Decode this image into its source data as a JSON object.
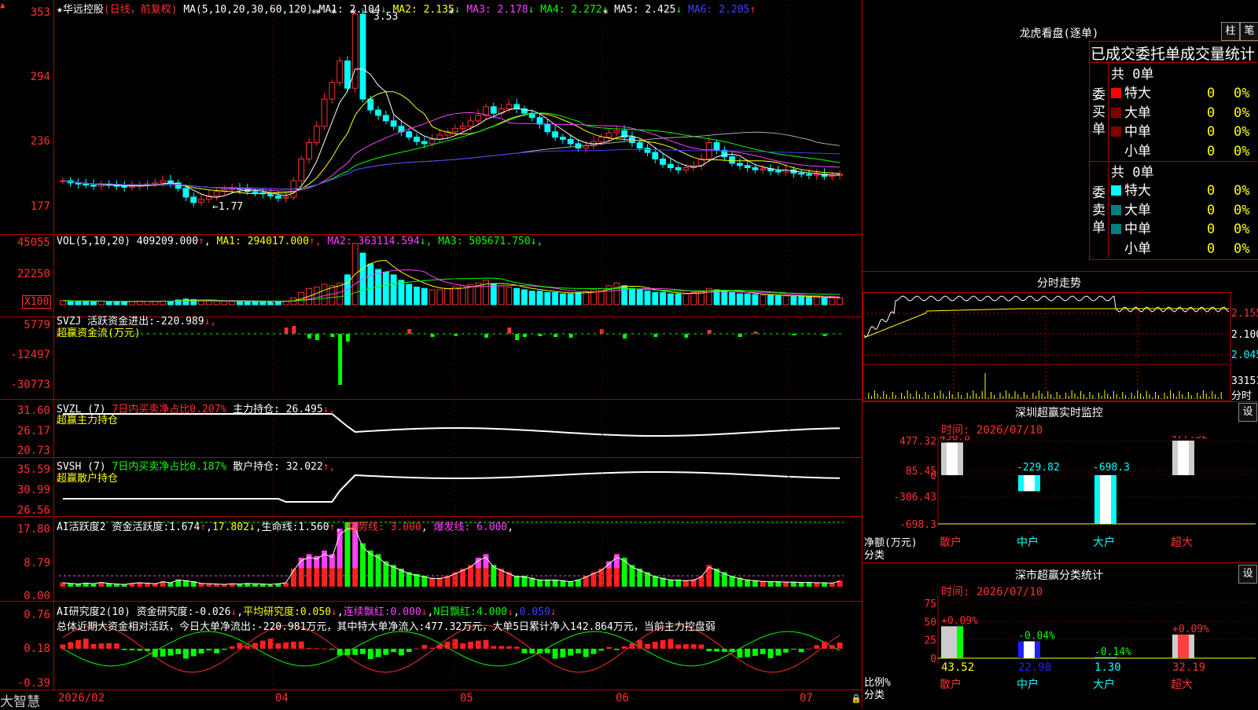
{
  "stock": {
    "name": "华远控股",
    "mode": "(日线，前复权)",
    "ma_header": "MA(5,10,20,30,60,120)",
    "ma_values": [
      {
        "label": "MA1:",
        "value": "2.104",
        "arrow": "↓",
        "color": "#ffffff"
      },
      {
        "label": "MA2:",
        "value": "2.135",
        "arrow": "↓",
        "color": "#ffff00"
      },
      {
        "label": "MA3:",
        "value": "2.178",
        "arrow": "↓",
        "color": "#ff40ff"
      },
      {
        "label": "MA4:",
        "value": "2.272",
        "arrow": "↓",
        "color": "#00ff00"
      },
      {
        "label": "MA5:",
        "value": "2.425",
        "arrow": "↓",
        "color": "#ffffff"
      },
      {
        "label": "MA6:",
        "value": "2.205",
        "arrow": "↑",
        "color": "#4040ff"
      }
    ],
    "high_mark": "3.53",
    "low_mark": "1.77",
    "y_ticks": [
      "353",
      "294",
      "236",
      "177"
    ]
  },
  "vol": {
    "header": "VOL(5,10,20)",
    "value": "409209.000",
    "arrow": "↑",
    "mas": [
      {
        "label": "MA1:",
        "value": "294017.000",
        "arrow": "↑",
        "color": "#ffff00"
      },
      {
        "label": "MA2:",
        "value": "363114.594",
        "arrow": "↓",
        "color": "#ff40ff"
      },
      {
        "label": "MA3:",
        "value": "505671.750",
        "arrow": "↓",
        "color": "#00ff00"
      }
    ],
    "y_ticks": [
      "45055",
      "22250"
    ],
    "unit": "X100"
  },
  "svzj": {
    "header": "SVZJ",
    "label": "活跃资金进出:",
    "value": "-220.989",
    "arrow": "↓,",
    "subtitle": "超赢资金流(万元)",
    "y_ticks": [
      "5779",
      "-12497",
      "-30773"
    ]
  },
  "svzl": {
    "header": "SVZL (7)",
    "ratio_label": "7日内买卖净占比0.207%",
    "hold_label": "主力持仓:",
    "hold_value": "26.495",
    "arrow": "↓,",
    "subtitle": "超赢主力持仓",
    "y_ticks": [
      "31.60",
      "26.17",
      "20.73"
    ]
  },
  "svsh": {
    "header": "SVSH (7)",
    "ratio_label": "7日内买卖净占比0.187%",
    "hold_label": "散户持仓:",
    "hold_value": "32.022",
    "arrow": "↑,",
    "subtitle": "超赢散户持仓",
    "y_ticks": [
      "35.59",
      "30.99",
      "26.56"
    ]
  },
  "ai_active": {
    "header": "AI活跃度2",
    "label": "资金活跃度:",
    "value": "1.674",
    "v2": "17.802",
    "life_label": "生命线:",
    "life_value": "1.560",
    "strong": "强势线: 3.000",
    "burst": "爆发线: 6.000",
    "y_ticks": [
      "17.80",
      "8.79",
      "0.00"
    ]
  },
  "ai_research": {
    "header": "AI研究度2(10)",
    "label": "资金研究度:",
    "value": "-0.026",
    "avg_label": "平均研究度:",
    "avg_value": "0.050",
    "streak_label": "连续飘红:",
    "streak_value": "0.000",
    "n_label": "N日飘红:",
    "n_value": "4.000",
    "last_value": "0.050",
    "summary": "总体近期大资金相对活跃，今日大单净流出:-220.981万元，其中特大单净流入:477.32万元，大单5日累计净入142.864万元，当前主力控盘弱",
    "y_ticks": [
      "0.76",
      "0.18",
      "-0.39"
    ]
  },
  "x_axis": {
    "labels": [
      "2026/02",
      "04",
      "05",
      "06",
      "07"
    ],
    "logo": "大智慧"
  },
  "dragon_tiger": {
    "title": "龙虎看盘(逐单)",
    "btn1": "柱",
    "btn2": "笔",
    "subtitle": "已成交委托单成交量统计",
    "buy_side": "委买单",
    "sell_side": "委卖单",
    "buy_total": "共 0单",
    "sell_total": "共 0单",
    "buy_rows": [
      {
        "name": "特大",
        "count": "0",
        "pct": "0%",
        "color": "#ff0000"
      },
      {
        "name": "大单",
        "count": "0",
        "pct": "0%",
        "color": "#800000"
      },
      {
        "name": "中单",
        "count": "0",
        "pct": "0%",
        "color": "#800000"
      },
      {
        "name": "小单",
        "count": "0",
        "pct": "0%",
        "color": ""
      }
    ],
    "sell_rows": [
      {
        "name": "特大",
        "count": "0",
        "pct": "0%",
        "color": "#00ffff"
      },
      {
        "name": "大单",
        "count": "0",
        "pct": "0%",
        "color": "#008080"
      },
      {
        "name": "中单",
        "count": "0",
        "pct": "0%",
        "color": "#008080"
      },
      {
        "name": "小单",
        "count": "0",
        "pct": "0%",
        "color": ""
      }
    ]
  },
  "intraday": {
    "title": "分时走势",
    "y_ticks": [
      "2.155",
      "2.100",
      "2.045"
    ],
    "vol_tick": "33151",
    "vol_label": "分时"
  },
  "monitor": {
    "title": "深圳超赢实时监控",
    "btn": "设",
    "time": "时间: 2026/07/10",
    "y_ticks": [
      "477.32",
      "85.45",
      "0",
      "-306.43",
      "-698.3"
    ],
    "unit_label": "净额(万元)",
    "cat_label": "分类",
    "bars": [
      {
        "name": "散户",
        "value": "450.8"
      },
      {
        "name": "中户",
        "value": "-229.82"
      },
      {
        "name": "大户",
        "value": "-698.3"
      },
      {
        "name": "超大",
        "value": "477.32"
      }
    ]
  },
  "classify": {
    "title": "深市超赢分类统计",
    "btn": "设",
    "time": "时间: 2026/07/10",
    "y_ticks": [
      "75",
      "50",
      "25",
      "0"
    ],
    "ratio_label": "比例%",
    "cat_label": "分类",
    "bars": [
      {
        "name": "散户",
        "pct": "+0.09%",
        "value": "43.52"
      },
      {
        "name": "中户",
        "pct": "-0.04%",
        "value": "22.98"
      },
      {
        "name": "大户",
        "pct": "-0.14%",
        "value": "1.30"
      },
      {
        "name": "超大",
        "pct": "+0.09%",
        "value": "32.19"
      }
    ]
  },
  "chart_data": {
    "type": "candlestick",
    "price_scale": [
      1.77,
      3.53
    ],
    "close": [
      2.0,
      1.98,
      1.97,
      1.96,
      1.95,
      1.97,
      1.96,
      1.95,
      1.94,
      1.95,
      1.96,
      1.97,
      1.98,
      2.0,
      1.98,
      1.93,
      1.85,
      1.8,
      1.83,
      1.86,
      1.9,
      1.92,
      1.93,
      1.92,
      1.9,
      1.89,
      1.88,
      1.86,
      1.84,
      1.85,
      2.0,
      2.2,
      2.35,
      2.5,
      2.75,
      2.9,
      3.1,
      2.85,
      3.53,
      2.75,
      2.65,
      2.6,
      2.55,
      2.5,
      2.45,
      2.4,
      2.36,
      2.34,
      2.38,
      2.42,
      2.45,
      2.48,
      2.5,
      2.55,
      2.6,
      2.68,
      2.62,
      2.66,
      2.7,
      2.66,
      2.62,
      2.58,
      2.52,
      2.45,
      2.4,
      2.38,
      2.34,
      2.3,
      2.32,
      2.36,
      2.4,
      2.44,
      2.46,
      2.4,
      2.35,
      2.3,
      2.26,
      2.2,
      2.15,
      2.12,
      2.1,
      2.12,
      2.14,
      2.2,
      2.35,
      2.28,
      2.22,
      2.16,
      2.14,
      2.12,
      2.1,
      2.11,
      2.09,
      2.08,
      2.1,
      2.07,
      2.06,
      2.05,
      2.06,
      2.04,
      2.05,
      2.06
    ],
    "vol_scale": [
      0,
      45055
    ],
    "volume": [
      3000,
      2800,
      2500,
      2600,
      2400,
      2600,
      2500,
      2400,
      2300,
      2500,
      2700,
      2600,
      2400,
      2800,
      2600,
      3500,
      4200,
      3800,
      3000,
      2800,
      2700,
      2600,
      2500,
      2400,
      2300,
      2500,
      2400,
      2300,
      2400,
      2600,
      5000,
      9000,
      12000,
      13000,
      15000,
      14000,
      16000,
      22000,
      45055,
      38000,
      30000,
      26000,
      24000,
      22000,
      18000,
      15000,
      13000,
      12000,
      11000,
      11000,
      12000,
      13000,
      14000,
      15000,
      16000,
      18000,
      15000,
      14000,
      13000,
      12000,
      11000,
      10000,
      10000,
      9000,
      9000,
      8000,
      8000,
      9000,
      10000,
      11000,
      12000,
      14000,
      16000,
      14000,
      12000,
      11000,
      10000,
      9000,
      9000,
      8000,
      8000,
      8000,
      9000,
      10000,
      12000,
      11000,
      10000,
      9000,
      8000,
      8000,
      7500,
      7000,
      7000,
      6500,
      6500,
      6000,
      6000,
      5500,
      5500,
      5000,
      5000,
      5000
    ],
    "ai_active": [
      1.2,
      1.0,
      0.8,
      1.1,
      0.9,
      1.3,
      1.0,
      0.8,
      0.7,
      1.0,
      1.2,
      1.1,
      0.9,
      1.5,
      1.2,
      2.0,
      1.8,
      1.5,
      1.0,
      0.9,
      0.8,
      0.7,
      0.9,
      0.8,
      1.0,
      0.9,
      0.8,
      0.7,
      0.9,
      1.2,
      5.0,
      8.0,
      9.0,
      8.5,
      10.0,
      9.0,
      16.0,
      17.8,
      17.8,
      12.0,
      10.0,
      9.0,
      7.0,
      6.0,
      5.0,
      4.0,
      3.5,
      3.0,
      2.5,
      2.5,
      3.0,
      4.0,
      5.0,
      6.0,
      8.0,
      9.0,
      6.0,
      5.0,
      4.0,
      3.0,
      3.0,
      2.5,
      2.0,
      2.0,
      2.0,
      1.8,
      1.5,
      2.0,
      3.0,
      4.0,
      5.0,
      7.0,
      9.0,
      8.0,
      6.0,
      5.0,
      4.0,
      3.0,
      2.5,
      2.0,
      2.0,
      1.8,
      2.0,
      3.0,
      6.0,
      5.0,
      4.0,
      3.0,
      2.5,
      2.0,
      1.8,
      1.6,
      1.5,
      1.5,
      1.4,
      1.4,
      1.3,
      1.3,
      1.2,
      1.2,
      1.1,
      1.7
    ]
  }
}
